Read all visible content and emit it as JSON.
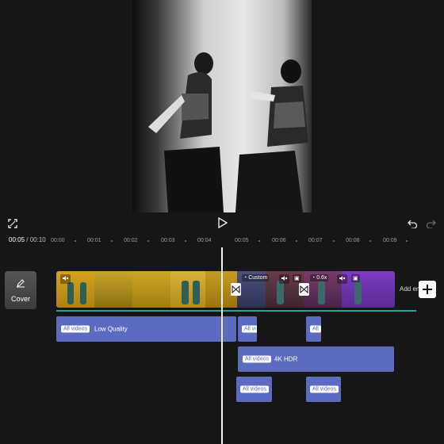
{
  "playback": {
    "current_time": "00:05",
    "separator": " / ",
    "total_time": "00:10"
  },
  "ruler": {
    "labels": [
      "00:00",
      "00:01",
      "00:02",
      "00:03",
      "00:04",
      "00:05",
      "00:06",
      "00:07",
      "00:08",
      "00:09"
    ]
  },
  "cover": {
    "label": "Cover"
  },
  "main_track": {
    "add_label": "Add ending",
    "segments": [
      {
        "speed_label": "Custom"
      },
      {
        "speed_label": "0.6x"
      }
    ]
  },
  "overlays": [
    {
      "tag": "All videos",
      "label": "Low Quality"
    },
    {
      "tag": "All vi",
      "label": ""
    },
    {
      "tag": "All",
      "label": ""
    },
    {
      "tag": "All videos",
      "label": "4K HDR"
    },
    {
      "tag": "All videos",
      "label": ""
    },
    {
      "tag": "All videos",
      "label": ""
    }
  ],
  "colors": {
    "overlay_fill": "#5c6bc0",
    "baseline": "#1fa59a",
    "playhead": "#f2f2f2",
    "background": "#161616"
  },
  "icons": [
    "fullscreen-icon",
    "play-icon",
    "undo-icon",
    "redo-icon",
    "edit-icon",
    "mute-icon",
    "speed-icon",
    "transition-icon",
    "add-icon"
  ]
}
